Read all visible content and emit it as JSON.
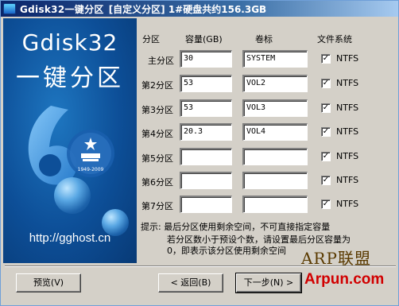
{
  "window": {
    "title": "Gdisk32一键分区",
    "subtitle": "[自定义分区]  1#硬盘共约156.3GB"
  },
  "art": {
    "logo_line1": "Gdisk32",
    "logo_line2": "一键分区",
    "big_number": "60",
    "anniversary_years": "1949-2009",
    "url": "http://gghost.cn"
  },
  "headers": {
    "partition": "分区",
    "capacity": "容量(GB)",
    "label": "卷标",
    "filesystem": "文件系统"
  },
  "rows": [
    {
      "name": "主分区",
      "capacity": "30",
      "label": "SYSTEM",
      "checked": true,
      "fs": "NTFS"
    },
    {
      "name": "第2分区",
      "capacity": "53",
      "label": "VOL2",
      "checked": true,
      "fs": "NTFS"
    },
    {
      "name": "第3分区",
      "capacity": "53",
      "label": "VOL3",
      "checked": true,
      "fs": "NTFS"
    },
    {
      "name": "第4分区",
      "capacity": "20.3",
      "label": "VOL4",
      "checked": true,
      "fs": "NTFS"
    },
    {
      "name": "第5分区",
      "capacity": "",
      "label": "",
      "checked": true,
      "fs": "NTFS"
    },
    {
      "name": "第6分区",
      "capacity": "",
      "label": "",
      "checked": true,
      "fs": "NTFS"
    },
    {
      "name": "第7分区",
      "capacity": "",
      "label": "",
      "checked": true,
      "fs": "NTFS"
    }
  ],
  "tip": {
    "line1": "提示: 最后分区使用剩余空间，不可直接指定容量",
    "line2": "若分区数小于预设个数，请设置最后分区容量为",
    "line3": "0，即表示该分区使用剩余空间"
  },
  "buttons": {
    "preview": "预览(V)",
    "back": "< 返回(B)",
    "next": "下一步(N) >"
  },
  "watermark": {
    "line1": "ARP联盟",
    "line2": "Arpun.com"
  },
  "colors": {
    "titlebar": "#0a246a",
    "art_background": "#0d4f98",
    "watermark_red": "#d10000"
  }
}
